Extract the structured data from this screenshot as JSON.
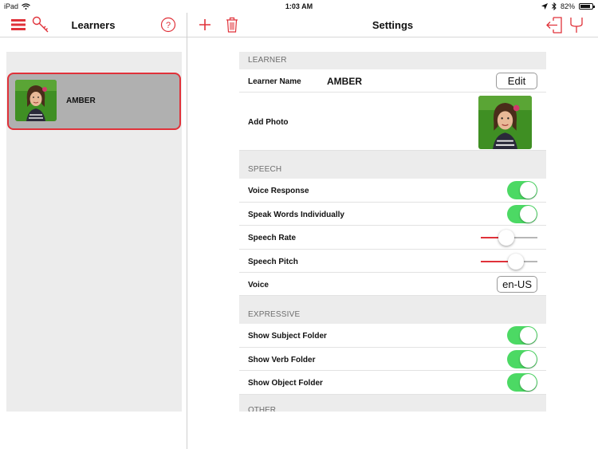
{
  "status_bar": {
    "device": "iPad",
    "time": "1:03 AM",
    "battery": "82%"
  },
  "left_pane": {
    "title": "Learners",
    "learners": [
      {
        "name": "AMBER",
        "selected": true
      }
    ]
  },
  "right_pane": {
    "title": "Settings",
    "sections": {
      "learner": {
        "header": "LEARNER",
        "name_label": "Learner Name",
        "name_value": "AMBER",
        "edit_label": "Edit",
        "photo_label": "Add Photo"
      },
      "speech": {
        "header": "SPEECH",
        "voice_response_label": "Voice Response",
        "voice_response_on": true,
        "speak_words_label": "Speak Words Individually",
        "speak_words_on": true,
        "rate_label": "Speech Rate",
        "rate_level": 0.45,
        "pitch_label": "Speech Pitch",
        "pitch_level": 0.62,
        "voice_label": "Voice",
        "voice_value": "en-US"
      },
      "expressive": {
        "header": "EXPRESSIVE",
        "subject_label": "Show Subject Folder",
        "subject_on": true,
        "verb_label": "Show Verb Folder",
        "verb_on": true,
        "object_label": "Show Object Folder",
        "object_on": true
      },
      "other": {
        "header": "OTHER"
      }
    }
  },
  "colors": {
    "accent": "#e0323a",
    "toggle_on": "#4cd964",
    "selected_row": "#b0b0b0",
    "group_bg": "#ececec"
  },
  "icons": [
    "menu-icon",
    "key-icon",
    "help-icon",
    "plus-icon",
    "trash-icon",
    "exit-icon",
    "fork-icon",
    "wifi-icon",
    "location-icon",
    "bluetooth-icon",
    "battery-icon"
  ]
}
